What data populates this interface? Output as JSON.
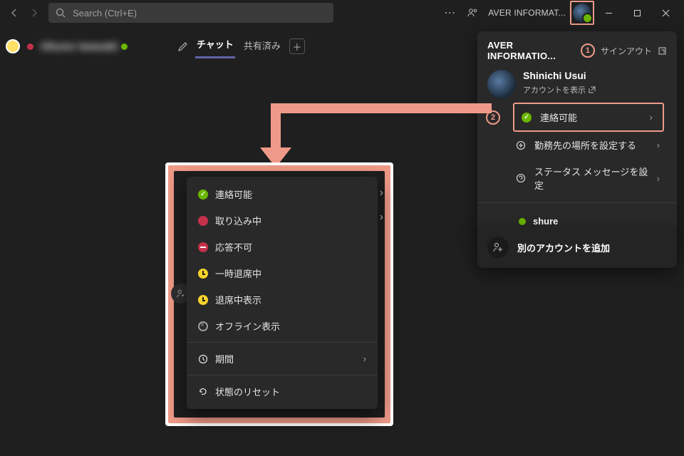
{
  "titlebar": {
    "search_placeholder": "Search (Ctrl+E)",
    "org_name": "AVER INFORMAT..."
  },
  "subheader": {
    "blurred_name": "Okuno   Iwasaki",
    "tab_chat": "チャット",
    "tab_shared": "共有済み"
  },
  "account_panel": {
    "title": "AVER INFORMATIO...",
    "signout": "サインアウト",
    "profile_name": "Shinichi Usui",
    "view_account": "アカウントを表示",
    "status_label": "連絡可能",
    "work_location": "勤務先の場所を設定する",
    "status_message": "ステータス メッセージを設定",
    "other_org": "shure"
  },
  "add_account": {
    "label": "別のアカウントを追加"
  },
  "status_menu": {
    "available": "連絡可能",
    "busy": "取り込み中",
    "dnd": "応答不可",
    "brb": "一時退席中",
    "away": "退席中表示",
    "offline": "オフライン表示",
    "duration": "期間",
    "reset": "状態のリセット"
  },
  "annotations": {
    "n1": "1",
    "n2": "2"
  }
}
